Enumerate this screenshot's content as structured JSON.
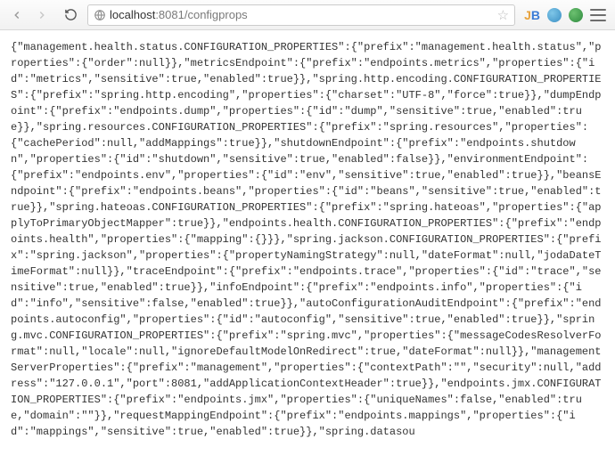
{
  "browser": {
    "url_host": "localhost",
    "url_port": ":8081",
    "url_path": "/configprops"
  },
  "body_text": "{\"management.health.status.CONFIGURATION_PROPERTIES\":{\"prefix\":\"management.health.status\",\"properties\":{\"order\":null}},\"metricsEndpoint\":{\"prefix\":\"endpoints.metrics\",\"properties\":{\"id\":\"metrics\",\"sensitive\":true,\"enabled\":true}},\"spring.http.encoding.CONFIGURATION_PROPERTIES\":{\"prefix\":\"spring.http.encoding\",\"properties\":{\"charset\":\"UTF-8\",\"force\":true}},\"dumpEndpoint\":{\"prefix\":\"endpoints.dump\",\"properties\":{\"id\":\"dump\",\"sensitive\":true,\"enabled\":true}},\"spring.resources.CONFIGURATION_PROPERTIES\":{\"prefix\":\"spring.resources\",\"properties\":{\"cachePeriod\":null,\"addMappings\":true}},\"shutdownEndpoint\":{\"prefix\":\"endpoints.shutdown\",\"properties\":{\"id\":\"shutdown\",\"sensitive\":true,\"enabled\":false}},\"environmentEndpoint\":{\"prefix\":\"endpoints.env\",\"properties\":{\"id\":\"env\",\"sensitive\":true,\"enabled\":true}},\"beansEndpoint\":{\"prefix\":\"endpoints.beans\",\"properties\":{\"id\":\"beans\",\"sensitive\":true,\"enabled\":true}},\"spring.hateoas.CONFIGURATION_PROPERTIES\":{\"prefix\":\"spring.hateoas\",\"properties\":{\"applyToPrimaryObjectMapper\":true}},\"endpoints.health.CONFIGURATION_PROPERTIES\":{\"prefix\":\"endpoints.health\",\"properties\":{\"mapping\":{}}},\"spring.jackson.CONFIGURATION_PROPERTIES\":{\"prefix\":\"spring.jackson\",\"properties\":{\"propertyNamingStrategy\":null,\"dateFormat\":null,\"jodaDateTimeFormat\":null}},\"traceEndpoint\":{\"prefix\":\"endpoints.trace\",\"properties\":{\"id\":\"trace\",\"sensitive\":true,\"enabled\":true}},\"infoEndpoint\":{\"prefix\":\"endpoints.info\",\"properties\":{\"id\":\"info\",\"sensitive\":false,\"enabled\":true}},\"autoConfigurationAuditEndpoint\":{\"prefix\":\"endpoints.autoconfig\",\"properties\":{\"id\":\"autoconfig\",\"sensitive\":true,\"enabled\":true}},\"spring.mvc.CONFIGURATION_PROPERTIES\":{\"prefix\":\"spring.mvc\",\"properties\":{\"messageCodesResolverFormat\":null,\"locale\":null,\"ignoreDefaultModelOnRedirect\":true,\"dateFormat\":null}},\"managementServerProperties\":{\"prefix\":\"management\",\"properties\":{\"contextPath\":\"\",\"security\":null,\"address\":\"127.0.0.1\",\"port\":8081,\"addApplicationContextHeader\":true}},\"endpoints.jmx.CONFIGURATION_PROPERTIES\":{\"prefix\":\"endpoints.jmx\",\"properties\":{\"uniqueNames\":false,\"enabled\":true,\"domain\":\"\"}},\"requestMappingEndpoint\":{\"prefix\":\"endpoints.mappings\",\"properties\":{\"id\":\"mappings\",\"sensitive\":true,\"enabled\":true}},\"spring.datasou"
}
